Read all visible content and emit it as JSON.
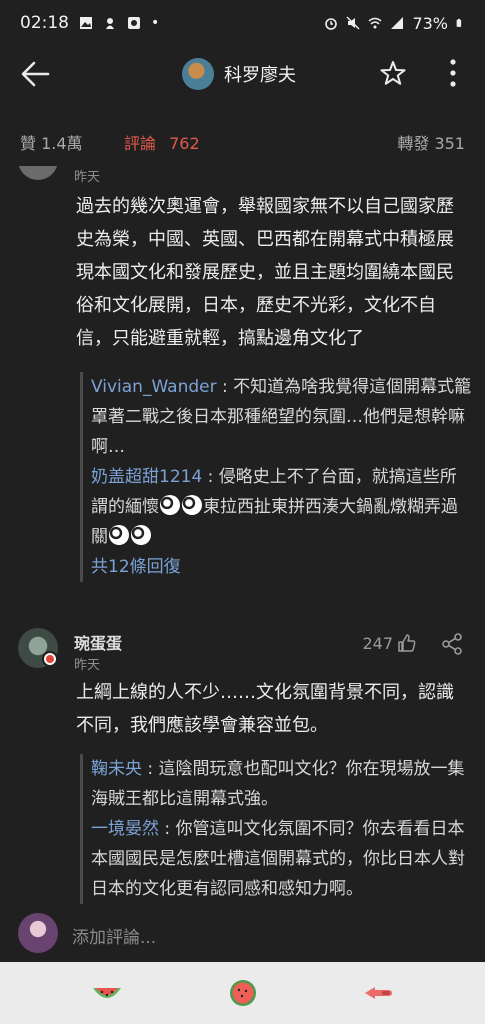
{
  "status": {
    "time": "02:18",
    "battery": "73%"
  },
  "header": {
    "title": "科罗廖夫"
  },
  "stats": {
    "likes": "贊 1.4萬",
    "comments_label": "評論",
    "comments_count": "762",
    "reposts": "轉發 351"
  },
  "comments": [
    {
      "time": "昨天",
      "text": "過去的幾次奧運會，舉報國家無不以自己國家歷史為榮，中國、英國、巴西都在開幕式中積極展現本國文化和發展歷史，並且主題均圍繞本國民俗和文化展開，日本，歷史不光彩，文化不自信，只能避重就輕，搞點邊角文化了",
      "replies": [
        {
          "user": "Vivian_Wander",
          "text": " : 不知道為啥我覺得這個開幕式籠罩著二戰之後日本那種絕望的氛圍…他們是想幹嘛啊…"
        },
        {
          "user": "奶盖超甜1214",
          "text_a": " : 侵略史上不了台面，就搞這些所謂的緬懷",
          "text_b": "東拉西扯東拼西湊大鍋亂燉糊弄過關"
        }
      ],
      "more": "共12條回復"
    },
    {
      "name": "琬蛋蛋",
      "time": "昨天",
      "likes": "247",
      "text": "上綱上線的人不少……文化氛圍背景不同，認識不同，我們應該學會兼容並包。",
      "replies": [
        {
          "user": "鞠未央",
          "text": " : 這陰間玩意也配叫文化？你在現場放一集海賊王都比這開幕式強。"
        },
        {
          "user": "一境晏然",
          "text": " : 你管這叫文化氛圍不同？你去看看日本本國國民是怎麼吐槽這個開幕式的，你比日本人對日本的文化更有認同感和感知力啊。"
        }
      ]
    }
  ],
  "input": {
    "placeholder": "添加評論..."
  }
}
